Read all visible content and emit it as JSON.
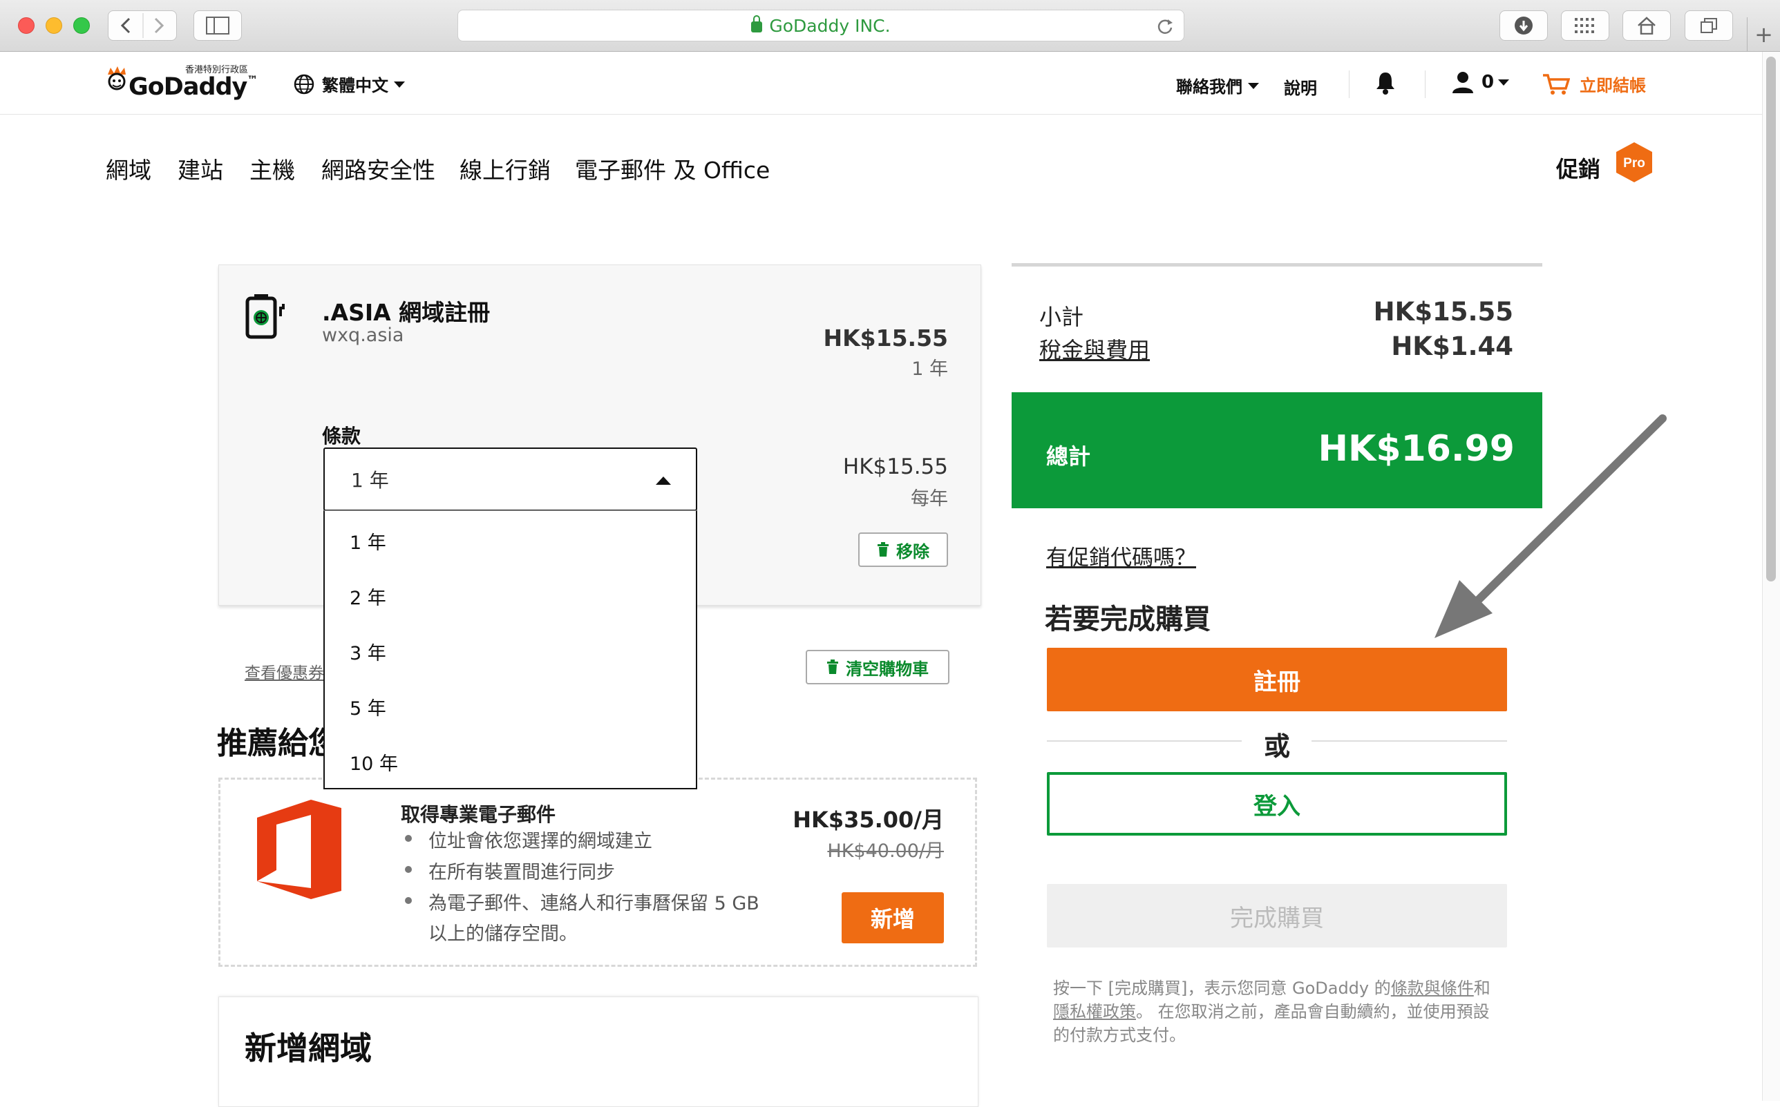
{
  "browser": {
    "url_text": "GoDaddy INC.",
    "new_tab_glyph": "+"
  },
  "header": {
    "logo_region": "香港特別行政區",
    "logo_text": "GoDaddy",
    "logo_tm": "™",
    "language": "繁體中文",
    "contact": "聯絡我們",
    "help": "說明",
    "account_count": "0",
    "checkout": "立即結帳"
  },
  "nav": {
    "items": [
      "網域",
      "建站",
      "主機",
      "網路安全性",
      "線上行銷",
      "電子郵件 及 Office"
    ],
    "promo": "促銷",
    "pro_badge": "Pro"
  },
  "cart": {
    "product_title": ".ASIA 網域註冊",
    "domain": "wxq.asia",
    "price": "HK$15.55",
    "price_period": "1 年",
    "term_label": "條款",
    "term_selected": "1 年",
    "term_options": [
      "1 年",
      "2 年",
      "3 年",
      "5 年",
      "10 年"
    ],
    "renew_price": "HK$15.55",
    "renew_period": "每年",
    "remove_button": "移除",
    "coupon_link": "查看優惠券",
    "clear_cart_button": "清空購物車"
  },
  "recommended": {
    "heading": "推薦給您",
    "title": "取得專業電子郵件",
    "bullets": [
      "位址會依您選擇的網域建立",
      "在所有裝置間進行同步",
      "為電子郵件、連絡人和行事曆保留 5 GB",
      "以上的儲存空間。"
    ],
    "price": "HK$35.00/月",
    "old_price": "HK$40.00/月",
    "add_button": "新增"
  },
  "add_domain": {
    "heading": "新增網域"
  },
  "summary": {
    "subtotal_label": "小計",
    "subtotal_value": "HK$15.55",
    "tax_label": "稅金與費用",
    "tax_value": "HK$1.44",
    "total_label": "總計",
    "total_value": "HK$16.99",
    "promo_link": "有促銷代碼嗎？",
    "complete_heading": "若要完成購買",
    "register_button": "註冊",
    "or_text": "或",
    "login_button": "登入",
    "complete_button": "完成購買",
    "terms_line1_a": "按一下 [完成購買]，表示您同意 GoDaddy 的",
    "terms_link1": "條款與條件",
    "terms_line1_b": "和",
    "terms_link2": "隱私權政策",
    "terms_line2_b": "。 在您取消之前，產品會自動續約，並使用預設",
    "terms_line3": "的付款方式支付。"
  },
  "colors": {
    "brand_green": "#0c9a3a",
    "orange": "#ef6c13",
    "office_red": "#e63b12",
    "link_green": "#0a8a2c"
  }
}
